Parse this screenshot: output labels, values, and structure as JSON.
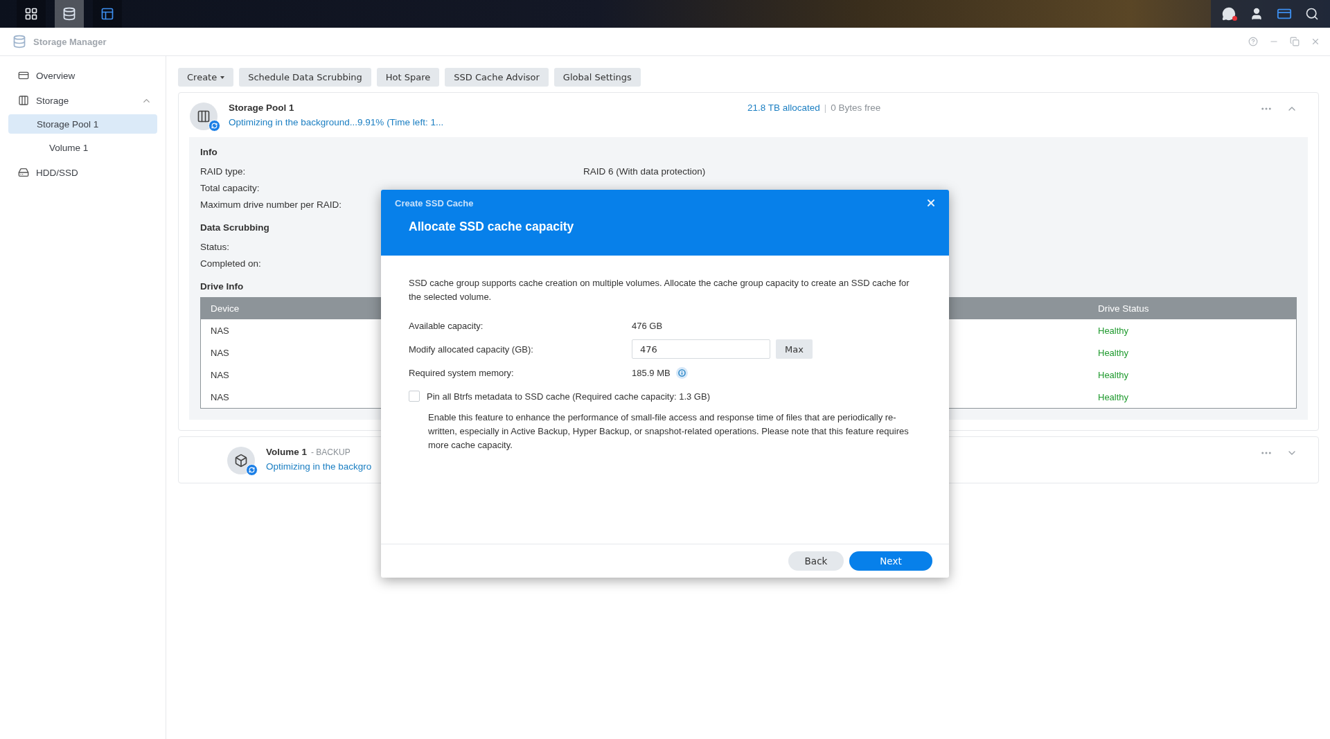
{
  "taskbar": {
    "apps": [
      {
        "kind": "grid",
        "selected": false
      },
      {
        "kind": "storage",
        "selected": true
      },
      {
        "kind": "panel",
        "selected": false
      }
    ],
    "tray": [
      {
        "kind": "chat",
        "alert": true
      },
      {
        "kind": "user",
        "alert": false
      },
      {
        "kind": "widgets",
        "alert": false
      },
      {
        "kind": "search",
        "alert": false
      }
    ]
  },
  "window": {
    "title": "Storage Manager"
  },
  "sidebar": {
    "items": [
      {
        "label": "Overview",
        "kind": "overview",
        "selected": false
      },
      {
        "label": "Storage",
        "kind": "storage",
        "selected": false,
        "expanded": true,
        "children": [
          {
            "label": "Storage Pool 1",
            "selected": true,
            "children": [
              {
                "label": "Volume 1",
                "selected": false
              }
            ]
          }
        ]
      },
      {
        "label": "HDD/SSD",
        "kind": "drive",
        "selected": false
      }
    ]
  },
  "toolbar": {
    "buttons": [
      {
        "label": "Create",
        "dropdown": true
      },
      {
        "label": "Schedule Data Scrubbing",
        "dropdown": false
      },
      {
        "label": "Hot Spare",
        "dropdown": false
      },
      {
        "label": "SSD Cache Advisor",
        "dropdown": false
      },
      {
        "label": "Global Settings",
        "dropdown": false
      }
    ]
  },
  "pool": {
    "title": "Storage Pool 1",
    "status": "Optimizing in the background...9.91% (Time left: 1...",
    "allocated": "21.8 TB allocated",
    "separator": "|",
    "free": "0 Bytes free",
    "expanded": true,
    "sections": [
      {
        "title": "Info",
        "rows": [
          {
            "label": "RAID type:",
            "value": "RAID 6 (With data protection)"
          },
          {
            "label": "Total capacity:"
          },
          {
            "label": "Maximum drive number per RAID:"
          }
        ]
      },
      {
        "title": "Data Scrubbing",
        "rows": [
          {
            "label": "Status:"
          },
          {
            "label": "Completed on:"
          }
        ]
      }
    ],
    "drive_info": {
      "title": "Drive Info",
      "columns": [
        "Device",
        "Drive Status"
      ],
      "rows": [
        {
          "device": "NAS",
          "status": "Healthy"
        },
        {
          "device": "NAS",
          "status": "Healthy"
        },
        {
          "device": "NAS",
          "status": "Healthy"
        },
        {
          "device": "NAS",
          "status": "Healthy"
        }
      ]
    }
  },
  "volume": {
    "title": "Volume 1",
    "tag": "- BACKUP",
    "status": "Optimizing in the backgro",
    "expanded": false
  },
  "dialog": {
    "caption": "Create SSD Cache",
    "title": "Allocate SSD cache capacity",
    "intro": "SSD cache group supports cache creation on multiple volumes. Allocate the cache group capacity to create an SSD cache for the selected volume.",
    "available": {
      "label": "Available capacity:",
      "value": "476 GB"
    },
    "modify": {
      "label": "Modify allocated capacity (GB):",
      "value": "476",
      "button": "Max"
    },
    "memory": {
      "label": "Required system memory:",
      "value": "185.9 MB"
    },
    "pin": {
      "label": "Pin all Btrfs metadata to SSD cache (Required cache capacity: 1.3 GB)",
      "checked": false,
      "note": "Enable this feature to enhance the performance of small-file access and response time of files that are periodically re-written, especially in Active Backup, Hyper Backup, or snapshot-related operations. Please note that this feature requires more cache capacity."
    },
    "buttons": [
      {
        "label": "Back",
        "primary": false
      },
      {
        "label": "Next",
        "primary": true
      }
    ]
  }
}
